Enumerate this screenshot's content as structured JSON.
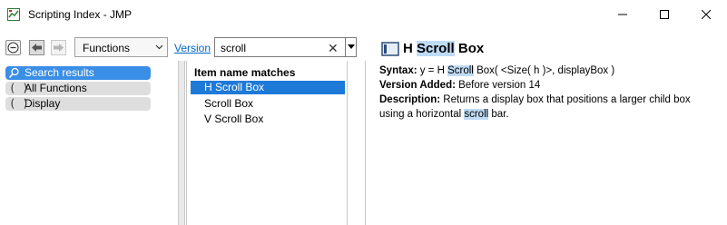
{
  "window": {
    "title": "Scripting Index - JMP"
  },
  "toolbar": {
    "category_select": "Functions",
    "version_link": "Version",
    "search_value": "scroll",
    "clear_glyph": "✕"
  },
  "left_panel": {
    "items": [
      {
        "label": "Search results",
        "icon": "search-results-icon"
      },
      {
        "label": "All Functions",
        "icon": "parens-icon"
      },
      {
        "label": "Display",
        "icon": "parens-icon"
      }
    ],
    "icon_glyph": "( )"
  },
  "middle_panel": {
    "header": "Item name matches",
    "items": [
      "H Scroll Box",
      "Scroll Box",
      "V Scroll Box"
    ]
  },
  "detail": {
    "title_prefix": "H ",
    "title_highlight": "Scroll",
    "title_suffix": " Box",
    "syntax_label": "Syntax:",
    "syntax_prefix": " y = H ",
    "syntax_highlight": "Scroll",
    "syntax_suffix": " Box( <Size( h )>, displayBox )",
    "version_label": "Version Added:",
    "version_value": " Before version 14",
    "description_label": "Description:",
    "description_line1": " Returns a display box that positions a larger child box",
    "description_line2_prefix": "using a horizontal ",
    "description_line2_highlight": "scroll",
    "description_line2_suffix": " bar."
  },
  "colors": {
    "selection": "#1e7ad8",
    "highlight": "#bfdbf5",
    "link": "#0066cc"
  }
}
